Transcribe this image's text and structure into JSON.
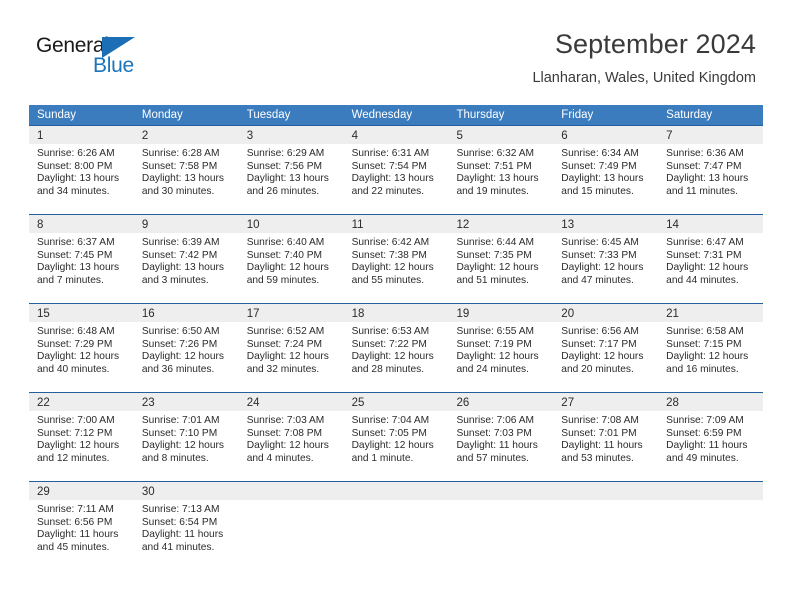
{
  "brand": {
    "name_line1": "General",
    "name_line2": "Blue",
    "accent_color": "#1c75bc",
    "triangle_color": "#1c6fb5"
  },
  "header": {
    "title": "September 2024",
    "subtitle": "Llanharan, Wales, United Kingdom"
  },
  "calendar": {
    "header_bg": "#3b7cbf",
    "row_border": "#225f9c",
    "day_band_bg": "#eeeeee",
    "weekdays": [
      "Sunday",
      "Monday",
      "Tuesday",
      "Wednesday",
      "Thursday",
      "Friday",
      "Saturday"
    ],
    "weeks": [
      [
        {
          "day": "1",
          "sunrise": "Sunrise: 6:26 AM",
          "sunset": "Sunset: 8:00 PM",
          "daylight_1": "Daylight: 13 hours",
          "daylight_2": "and 34 minutes."
        },
        {
          "day": "2",
          "sunrise": "Sunrise: 6:28 AM",
          "sunset": "Sunset: 7:58 PM",
          "daylight_1": "Daylight: 13 hours",
          "daylight_2": "and 30 minutes."
        },
        {
          "day": "3",
          "sunrise": "Sunrise: 6:29 AM",
          "sunset": "Sunset: 7:56 PM",
          "daylight_1": "Daylight: 13 hours",
          "daylight_2": "and 26 minutes."
        },
        {
          "day": "4",
          "sunrise": "Sunrise: 6:31 AM",
          "sunset": "Sunset: 7:54 PM",
          "daylight_1": "Daylight: 13 hours",
          "daylight_2": "and 22 minutes."
        },
        {
          "day": "5",
          "sunrise": "Sunrise: 6:32 AM",
          "sunset": "Sunset: 7:51 PM",
          "daylight_1": "Daylight: 13 hours",
          "daylight_2": "and 19 minutes."
        },
        {
          "day": "6",
          "sunrise": "Sunrise: 6:34 AM",
          "sunset": "Sunset: 7:49 PM",
          "daylight_1": "Daylight: 13 hours",
          "daylight_2": "and 15 minutes."
        },
        {
          "day": "7",
          "sunrise": "Sunrise: 6:36 AM",
          "sunset": "Sunset: 7:47 PM",
          "daylight_1": "Daylight: 13 hours",
          "daylight_2": "and 11 minutes."
        }
      ],
      [
        {
          "day": "8",
          "sunrise": "Sunrise: 6:37 AM",
          "sunset": "Sunset: 7:45 PM",
          "daylight_1": "Daylight: 13 hours",
          "daylight_2": "and 7 minutes."
        },
        {
          "day": "9",
          "sunrise": "Sunrise: 6:39 AM",
          "sunset": "Sunset: 7:42 PM",
          "daylight_1": "Daylight: 13 hours",
          "daylight_2": "and 3 minutes."
        },
        {
          "day": "10",
          "sunrise": "Sunrise: 6:40 AM",
          "sunset": "Sunset: 7:40 PM",
          "daylight_1": "Daylight: 12 hours",
          "daylight_2": "and 59 minutes."
        },
        {
          "day": "11",
          "sunrise": "Sunrise: 6:42 AM",
          "sunset": "Sunset: 7:38 PM",
          "daylight_1": "Daylight: 12 hours",
          "daylight_2": "and 55 minutes."
        },
        {
          "day": "12",
          "sunrise": "Sunrise: 6:44 AM",
          "sunset": "Sunset: 7:35 PM",
          "daylight_1": "Daylight: 12 hours",
          "daylight_2": "and 51 minutes."
        },
        {
          "day": "13",
          "sunrise": "Sunrise: 6:45 AM",
          "sunset": "Sunset: 7:33 PM",
          "daylight_1": "Daylight: 12 hours",
          "daylight_2": "and 47 minutes."
        },
        {
          "day": "14",
          "sunrise": "Sunrise: 6:47 AM",
          "sunset": "Sunset: 7:31 PM",
          "daylight_1": "Daylight: 12 hours",
          "daylight_2": "and 44 minutes."
        }
      ],
      [
        {
          "day": "15",
          "sunrise": "Sunrise: 6:48 AM",
          "sunset": "Sunset: 7:29 PM",
          "daylight_1": "Daylight: 12 hours",
          "daylight_2": "and 40 minutes."
        },
        {
          "day": "16",
          "sunrise": "Sunrise: 6:50 AM",
          "sunset": "Sunset: 7:26 PM",
          "daylight_1": "Daylight: 12 hours",
          "daylight_2": "and 36 minutes."
        },
        {
          "day": "17",
          "sunrise": "Sunrise: 6:52 AM",
          "sunset": "Sunset: 7:24 PM",
          "daylight_1": "Daylight: 12 hours",
          "daylight_2": "and 32 minutes."
        },
        {
          "day": "18",
          "sunrise": "Sunrise: 6:53 AM",
          "sunset": "Sunset: 7:22 PM",
          "daylight_1": "Daylight: 12 hours",
          "daylight_2": "and 28 minutes."
        },
        {
          "day": "19",
          "sunrise": "Sunrise: 6:55 AM",
          "sunset": "Sunset: 7:19 PM",
          "daylight_1": "Daylight: 12 hours",
          "daylight_2": "and 24 minutes."
        },
        {
          "day": "20",
          "sunrise": "Sunrise: 6:56 AM",
          "sunset": "Sunset: 7:17 PM",
          "daylight_1": "Daylight: 12 hours",
          "daylight_2": "and 20 minutes."
        },
        {
          "day": "21",
          "sunrise": "Sunrise: 6:58 AM",
          "sunset": "Sunset: 7:15 PM",
          "daylight_1": "Daylight: 12 hours",
          "daylight_2": "and 16 minutes."
        }
      ],
      [
        {
          "day": "22",
          "sunrise": "Sunrise: 7:00 AM",
          "sunset": "Sunset: 7:12 PM",
          "daylight_1": "Daylight: 12 hours",
          "daylight_2": "and 12 minutes."
        },
        {
          "day": "23",
          "sunrise": "Sunrise: 7:01 AM",
          "sunset": "Sunset: 7:10 PM",
          "daylight_1": "Daylight: 12 hours",
          "daylight_2": "and 8 minutes."
        },
        {
          "day": "24",
          "sunrise": "Sunrise: 7:03 AM",
          "sunset": "Sunset: 7:08 PM",
          "daylight_1": "Daylight: 12 hours",
          "daylight_2": "and 4 minutes."
        },
        {
          "day": "25",
          "sunrise": "Sunrise: 7:04 AM",
          "sunset": "Sunset: 7:05 PM",
          "daylight_1": "Daylight: 12 hours",
          "daylight_2": "and 1 minute."
        },
        {
          "day": "26",
          "sunrise": "Sunrise: 7:06 AM",
          "sunset": "Sunset: 7:03 PM",
          "daylight_1": "Daylight: 11 hours",
          "daylight_2": "and 57 minutes."
        },
        {
          "day": "27",
          "sunrise": "Sunrise: 7:08 AM",
          "sunset": "Sunset: 7:01 PM",
          "daylight_1": "Daylight: 11 hours",
          "daylight_2": "and 53 minutes."
        },
        {
          "day": "28",
          "sunrise": "Sunrise: 7:09 AM",
          "sunset": "Sunset: 6:59 PM",
          "daylight_1": "Daylight: 11 hours",
          "daylight_2": "and 49 minutes."
        }
      ],
      [
        {
          "day": "29",
          "sunrise": "Sunrise: 7:11 AM",
          "sunset": "Sunset: 6:56 PM",
          "daylight_1": "Daylight: 11 hours",
          "daylight_2": "and 45 minutes."
        },
        {
          "day": "30",
          "sunrise": "Sunrise: 7:13 AM",
          "sunset": "Sunset: 6:54 PM",
          "daylight_1": "Daylight: 11 hours",
          "daylight_2": "and 41 minutes."
        },
        {
          "day": "",
          "sunrise": "",
          "sunset": "",
          "daylight_1": "",
          "daylight_2": ""
        },
        {
          "day": "",
          "sunrise": "",
          "sunset": "",
          "daylight_1": "",
          "daylight_2": ""
        },
        {
          "day": "",
          "sunrise": "",
          "sunset": "",
          "daylight_1": "",
          "daylight_2": ""
        },
        {
          "day": "",
          "sunrise": "",
          "sunset": "",
          "daylight_1": "",
          "daylight_2": ""
        },
        {
          "day": "",
          "sunrise": "",
          "sunset": "",
          "daylight_1": "",
          "daylight_2": ""
        }
      ]
    ]
  }
}
